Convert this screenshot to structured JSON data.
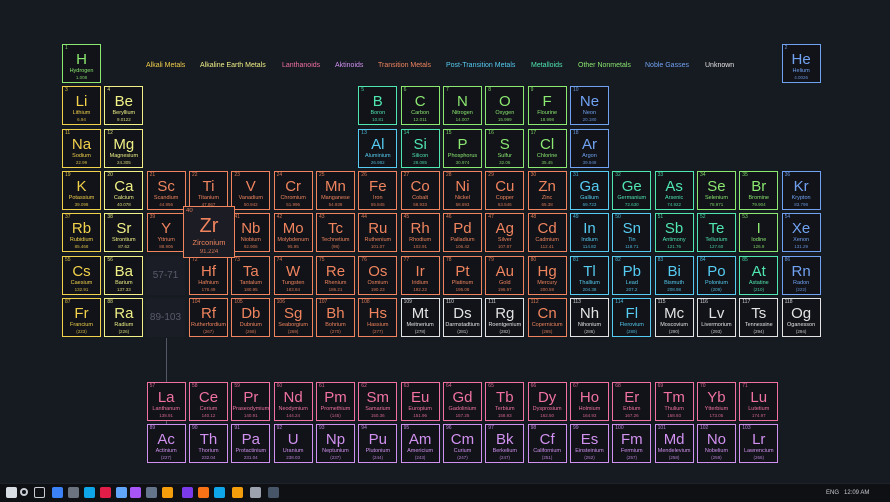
{
  "colors": {
    "alkali": "#f2d14b",
    "alkaline": "#f1f187",
    "lanthanoid": "#f071a2",
    "actinoid": "#d191f0",
    "transition": "#f0845e",
    "post_transition": "#56ccf2",
    "metalloid": "#4fe6b0",
    "nonmetal": "#8be870",
    "noble": "#71a2f2",
    "unknown": "#e4e4e4"
  },
  "legend": [
    {
      "label": "Alkali Metals",
      "cat": "alkali"
    },
    {
      "label": "Alkaline Earth Metals",
      "cat": "alkaline"
    },
    {
      "label": "Lanthanoids",
      "cat": "lanthanoid"
    },
    {
      "label": "Aktinoids",
      "cat": "actinoid"
    },
    {
      "label": "Transition Metals",
      "cat": "transition"
    },
    {
      "label": "Post-Transition Metals",
      "cat": "post_transition"
    },
    {
      "label": "Metalloids",
      "cat": "metalloid"
    },
    {
      "label": "Other Nonmetals",
      "cat": "nonmetal"
    },
    {
      "label": "Noble Gasses",
      "cat": "noble"
    },
    {
      "label": "Unknown",
      "cat": "unknown"
    }
  ],
  "placeholders": {
    "lanthanoid_range": "57-71",
    "actinoid_range": "89-103"
  },
  "hovered": {
    "number": "40",
    "symbol": "Zr",
    "name": "Zirconium",
    "weight": "91.224"
  },
  "elements": [
    {
      "n": 1,
      "s": "H",
      "name": "Hydrogen",
      "w": "1.008",
      "c": "nonmetal"
    },
    {
      "n": 2,
      "s": "He",
      "name": "Helium",
      "w": "4.0026",
      "c": "noble"
    },
    {
      "n": 3,
      "s": "Li",
      "name": "Lithium",
      "w": "6.94",
      "c": "alkali"
    },
    {
      "n": 4,
      "s": "Be",
      "name": "Beryllium",
      "w": "9.0122",
      "c": "alkaline"
    },
    {
      "n": 5,
      "s": "B",
      "name": "Boron",
      "w": "10.81",
      "c": "metalloid"
    },
    {
      "n": 6,
      "s": "C",
      "name": "Carbon",
      "w": "12.011",
      "c": "nonmetal"
    },
    {
      "n": 7,
      "s": "N",
      "name": "Nitrogen",
      "w": "14.007",
      "c": "nonmetal"
    },
    {
      "n": 8,
      "s": "O",
      "name": "Oxygen",
      "w": "15.999",
      "c": "nonmetal"
    },
    {
      "n": 9,
      "s": "F",
      "name": "Flourine",
      "w": "18.998",
      "c": "nonmetal"
    },
    {
      "n": 10,
      "s": "Ne",
      "name": "Neon",
      "w": "20.180",
      "c": "noble"
    },
    {
      "n": 11,
      "s": "Na",
      "name": "Sodium",
      "w": "22.99",
      "c": "alkali"
    },
    {
      "n": 12,
      "s": "Mg",
      "name": "Magnesium",
      "w": "24.305",
      "c": "alkaline"
    },
    {
      "n": 13,
      "s": "Al",
      "name": "Aluminium",
      "w": "26.982",
      "c": "post_transition"
    },
    {
      "n": 14,
      "s": "Si",
      "name": "Silicon",
      "w": "28.085",
      "c": "metalloid"
    },
    {
      "n": 15,
      "s": "P",
      "name": "Phosphorus",
      "w": "30.974",
      "c": "nonmetal"
    },
    {
      "n": 16,
      "s": "S",
      "name": "Sulfur",
      "w": "32.06",
      "c": "nonmetal"
    },
    {
      "n": 17,
      "s": "Cl",
      "name": "Chlorine",
      "w": "35.45",
      "c": "nonmetal"
    },
    {
      "n": 18,
      "s": "Ar",
      "name": "Argon",
      "w": "39.948",
      "c": "noble"
    },
    {
      "n": 19,
      "s": "K",
      "name": "Potassium",
      "w": "39.098",
      "c": "alkali"
    },
    {
      "n": 20,
      "s": "Ca",
      "name": "Calcium",
      "w": "40.078",
      "c": "alkaline"
    },
    {
      "n": 21,
      "s": "Sc",
      "name": "Scandium",
      "w": "44.956",
      "c": "transition"
    },
    {
      "n": 22,
      "s": "Ti",
      "name": "Titanium",
      "w": "47.867",
      "c": "transition"
    },
    {
      "n": 23,
      "s": "V",
      "name": "Vanadium",
      "w": "50.942",
      "c": "transition"
    },
    {
      "n": 24,
      "s": "Cr",
      "name": "Chromium",
      "w": "51.996",
      "c": "transition"
    },
    {
      "n": 25,
      "s": "Mn",
      "name": "Manganese",
      "w": "54.938",
      "c": "transition"
    },
    {
      "n": 26,
      "s": "Fe",
      "name": "Iron",
      "w": "55.845",
      "c": "transition"
    },
    {
      "n": 27,
      "s": "Co",
      "name": "Cobalt",
      "w": "58.933",
      "c": "transition"
    },
    {
      "n": 28,
      "s": "Ni",
      "name": "Nickel",
      "w": "58.693",
      "c": "transition"
    },
    {
      "n": 29,
      "s": "Cu",
      "name": "Copper",
      "w": "63.546",
      "c": "transition"
    },
    {
      "n": 30,
      "s": "Zn",
      "name": "Zinc",
      "w": "65.38",
      "c": "transition"
    },
    {
      "n": 31,
      "s": "Ga",
      "name": "Gallium",
      "w": "69.723",
      "c": "post_transition"
    },
    {
      "n": 32,
      "s": "Ge",
      "name": "Germanium",
      "w": "72.630",
      "c": "metalloid"
    },
    {
      "n": 33,
      "s": "As",
      "name": "Arsenic",
      "w": "74.922",
      "c": "metalloid"
    },
    {
      "n": 34,
      "s": "Se",
      "name": "Selenium",
      "w": "78.971",
      "c": "nonmetal"
    },
    {
      "n": 35,
      "s": "Br",
      "name": "Bromine",
      "w": "79.904",
      "c": "nonmetal"
    },
    {
      "n": 36,
      "s": "Kr",
      "name": "Krypton",
      "w": "83.798",
      "c": "noble"
    },
    {
      "n": 37,
      "s": "Rb",
      "name": "Rubidium",
      "w": "85.468",
      "c": "alkali"
    },
    {
      "n": 38,
      "s": "Sr",
      "name": "Strontium",
      "w": "87.62",
      "c": "alkaline"
    },
    {
      "n": 39,
      "s": "Y",
      "name": "Yttrium",
      "w": "88.906",
      "c": "transition"
    },
    {
      "n": 41,
      "s": "Nb",
      "name": "Niobium",
      "w": "92.906",
      "c": "transition"
    },
    {
      "n": 42,
      "s": "Mo",
      "name": "Molybdenum",
      "w": "95.95",
      "c": "transition"
    },
    {
      "n": 43,
      "s": "Tc",
      "name": "Technetium",
      "w": "(98)",
      "c": "transition"
    },
    {
      "n": 44,
      "s": "Ru",
      "name": "Ruthenium",
      "w": "101.07",
      "c": "transition"
    },
    {
      "n": 45,
      "s": "Rh",
      "name": "Rhodium",
      "w": "102.91",
      "c": "transition"
    },
    {
      "n": 46,
      "s": "Pd",
      "name": "Palladium",
      "w": "106.42",
      "c": "transition"
    },
    {
      "n": 47,
      "s": "Ag",
      "name": "Silver",
      "w": "107.87",
      "c": "transition"
    },
    {
      "n": 48,
      "s": "Cd",
      "name": "Cadmium",
      "w": "112.41",
      "c": "transition"
    },
    {
      "n": 49,
      "s": "In",
      "name": "Indium",
      "w": "114.82",
      "c": "post_transition"
    },
    {
      "n": 50,
      "s": "Sn",
      "name": "Tin",
      "w": "118.71",
      "c": "post_transition"
    },
    {
      "n": 51,
      "s": "Sb",
      "name": "Antimony",
      "w": "121.76",
      "c": "metalloid"
    },
    {
      "n": 52,
      "s": "Te",
      "name": "Tellurium",
      "w": "127.60",
      "c": "metalloid"
    },
    {
      "n": 53,
      "s": "I",
      "name": "Iodine",
      "w": "126.9",
      "c": "nonmetal"
    },
    {
      "n": 54,
      "s": "Xe",
      "name": "Xenon",
      "w": "131.29",
      "c": "noble"
    },
    {
      "n": 55,
      "s": "Cs",
      "name": "Caesium",
      "w": "132.91",
      "c": "alkali"
    },
    {
      "n": 56,
      "s": "Ba",
      "name": "Barium",
      "w": "137.33",
      "c": "alkaline"
    },
    {
      "n": 72,
      "s": "Hf",
      "name": "Hafnium",
      "w": "178.49",
      "c": "transition"
    },
    {
      "n": 73,
      "s": "Ta",
      "name": "Tantalum",
      "w": "180.95",
      "c": "transition"
    },
    {
      "n": 74,
      "s": "W",
      "name": "Tungsten",
      "w": "183.84",
      "c": "transition"
    },
    {
      "n": 75,
      "s": "Re",
      "name": "Rhenium",
      "w": "186.21",
      "c": "transition"
    },
    {
      "n": 76,
      "s": "Os",
      "name": "Osmium",
      "w": "190.23",
      "c": "transition"
    },
    {
      "n": 77,
      "s": "Ir",
      "name": "Iridium",
      "w": "192.22",
      "c": "transition"
    },
    {
      "n": 78,
      "s": "Pt",
      "name": "Platinum",
      "w": "195.08",
      "c": "transition"
    },
    {
      "n": 79,
      "s": "Au",
      "name": "Gold",
      "w": "196.97",
      "c": "transition"
    },
    {
      "n": 80,
      "s": "Hg",
      "name": "Mercury",
      "w": "200.59",
      "c": "transition"
    },
    {
      "n": 81,
      "s": "Tl",
      "name": "Thallium",
      "w": "204.38",
      "c": "post_transition"
    },
    {
      "n": 82,
      "s": "Pb",
      "name": "Lead",
      "w": "207.2",
      "c": "post_transition"
    },
    {
      "n": 83,
      "s": "Bi",
      "name": "Bismuth",
      "w": "208.98",
      "c": "post_transition"
    },
    {
      "n": 84,
      "s": "Po",
      "name": "Polonium",
      "w": "(209)",
      "c": "post_transition"
    },
    {
      "n": 85,
      "s": "At",
      "name": "Astatine",
      "w": "(210)",
      "c": "metalloid"
    },
    {
      "n": 86,
      "s": "Rn",
      "name": "Radon",
      "w": "(222)",
      "c": "noble"
    },
    {
      "n": 87,
      "s": "Fr",
      "name": "Francium",
      "w": "(223)",
      "c": "alkali"
    },
    {
      "n": 88,
      "s": "Ra",
      "name": "Radium",
      "w": "(226)",
      "c": "alkaline"
    },
    {
      "n": 104,
      "s": "Rf",
      "name": "Rutherfordium",
      "w": "(267)",
      "c": "transition"
    },
    {
      "n": 105,
      "s": "Db",
      "name": "Dubnium",
      "w": "(268)",
      "c": "transition"
    },
    {
      "n": 106,
      "s": "Sg",
      "name": "Seaborgium",
      "w": "(269)",
      "c": "transition"
    },
    {
      "n": 107,
      "s": "Bh",
      "name": "Bohrium",
      "w": "(270)",
      "c": "transition"
    },
    {
      "n": 108,
      "s": "Hs",
      "name": "Hassium",
      "w": "(277)",
      "c": "transition"
    },
    {
      "n": 109,
      "s": "Mt",
      "name": "Meitnerium",
      "w": "(278)",
      "c": "unknown"
    },
    {
      "n": 110,
      "s": "Ds",
      "name": "Darmstadtium",
      "w": "(281)",
      "c": "unknown"
    },
    {
      "n": 111,
      "s": "Rg",
      "name": "Roentgenium",
      "w": "(282)",
      "c": "unknown"
    },
    {
      "n": 112,
      "s": "Cn",
      "name": "Copernicium",
      "w": "(285)",
      "c": "transition"
    },
    {
      "n": 113,
      "s": "Nh",
      "name": "Nihonium",
      "w": "(286)",
      "c": "unknown"
    },
    {
      "n": 114,
      "s": "Fl",
      "name": "Flerovium",
      "w": "(289)",
      "c": "post_transition"
    },
    {
      "n": 115,
      "s": "Mc",
      "name": "Moscovium",
      "w": "(290)",
      "c": "unknown"
    },
    {
      "n": 116,
      "s": "Lv",
      "name": "Livermorium",
      "w": "(293)",
      "c": "unknown"
    },
    {
      "n": 117,
      "s": "Ts",
      "name": "Tennessine",
      "w": "(294)",
      "c": "unknown"
    },
    {
      "n": 118,
      "s": "Og",
      "name": "Oganesson",
      "w": "(294)",
      "c": "unknown"
    },
    {
      "n": 57,
      "s": "La",
      "name": "Lanthanum",
      "w": "138.91",
      "c": "lanthanoid"
    },
    {
      "n": 58,
      "s": "Ce",
      "name": "Cerium",
      "w": "140.12",
      "c": "lanthanoid"
    },
    {
      "n": 59,
      "s": "Pr",
      "name": "Praseodymium",
      "w": "140.91",
      "c": "lanthanoid"
    },
    {
      "n": 60,
      "s": "Nd",
      "name": "Neodymium",
      "w": "144.24",
      "c": "lanthanoid"
    },
    {
      "n": 61,
      "s": "Pm",
      "name": "Promethium",
      "w": "(145)",
      "c": "lanthanoid"
    },
    {
      "n": 62,
      "s": "Sm",
      "name": "Samarium",
      "w": "150.36",
      "c": "lanthanoid"
    },
    {
      "n": 63,
      "s": "Eu",
      "name": "Europium",
      "w": "151.96",
      "c": "lanthanoid"
    },
    {
      "n": 64,
      "s": "Gd",
      "name": "Gadolinium",
      "w": "157.25",
      "c": "lanthanoid"
    },
    {
      "n": 65,
      "s": "Tb",
      "name": "Terbium",
      "w": "158.93",
      "c": "lanthanoid"
    },
    {
      "n": 66,
      "s": "Dy",
      "name": "Dysprosium",
      "w": "162.50",
      "c": "lanthanoid"
    },
    {
      "n": 67,
      "s": "Ho",
      "name": "Holmium",
      "w": "164.93",
      "c": "lanthanoid"
    },
    {
      "n": 68,
      "s": "Er",
      "name": "Erbium",
      "w": "167.26",
      "c": "lanthanoid"
    },
    {
      "n": 69,
      "s": "Tm",
      "name": "Thulium",
      "w": "168.93",
      "c": "lanthanoid"
    },
    {
      "n": 70,
      "s": "Yb",
      "name": "Ytterbium",
      "w": "173.05",
      "c": "lanthanoid"
    },
    {
      "n": 71,
      "s": "Lu",
      "name": "Lutetium",
      "w": "174.97",
      "c": "lanthanoid"
    },
    {
      "n": 89,
      "s": "Ac",
      "name": "Actinium",
      "w": "(227)",
      "c": "actinoid"
    },
    {
      "n": 90,
      "s": "Th",
      "name": "Thorium",
      "w": "232.04",
      "c": "actinoid"
    },
    {
      "n": 91,
      "s": "Pa",
      "name": "Protactinium",
      "w": "231.04",
      "c": "actinoid"
    },
    {
      "n": 92,
      "s": "U",
      "name": "Uranium",
      "w": "238.03",
      "c": "actinoid"
    },
    {
      "n": 93,
      "s": "Np",
      "name": "Neptunium",
      "w": "(237)",
      "c": "actinoid"
    },
    {
      "n": 94,
      "s": "Pu",
      "name": "Plutonium",
      "w": "(244)",
      "c": "actinoid"
    },
    {
      "n": 95,
      "s": "Am",
      "name": "Americium",
      "w": "(243)",
      "c": "actinoid"
    },
    {
      "n": 96,
      "s": "Cm",
      "name": "Curium",
      "w": "(247)",
      "c": "actinoid"
    },
    {
      "n": 97,
      "s": "Bk",
      "name": "Berkelium",
      "w": "(247)",
      "c": "actinoid"
    },
    {
      "n": 98,
      "s": "Cf",
      "name": "Californium",
      "w": "(251)",
      "c": "actinoid"
    },
    {
      "n": 99,
      "s": "Es",
      "name": "Einsteinium",
      "w": "(252)",
      "c": "actinoid"
    },
    {
      "n": 100,
      "s": "Fm",
      "name": "Fermium",
      "w": "(257)",
      "c": "actinoid"
    },
    {
      "n": 101,
      "s": "Md",
      "name": "Mendelevium",
      "w": "(258)",
      "c": "actinoid"
    },
    {
      "n": 102,
      "s": "No",
      "name": "Nobelium",
      "w": "(259)",
      "c": "actinoid"
    },
    {
      "n": 103,
      "s": "Lr",
      "name": "Lawrencium",
      "w": "(266)",
      "c": "actinoid"
    }
  ],
  "taskbar": {
    "icons": [
      "windows-icon",
      "search-icon",
      "task-view-icon",
      "todo-icon",
      "terminal-icon",
      "mail-icon",
      "music-icon",
      "photos-icon",
      "chat-icon",
      "store-icon",
      "paint-icon",
      "visual-studio-icon",
      "video-icon",
      "edge-icon",
      "chrome-icon",
      "settings-icon",
      "steam-icon"
    ],
    "language": "ENG",
    "time": "12:09 AM"
  }
}
